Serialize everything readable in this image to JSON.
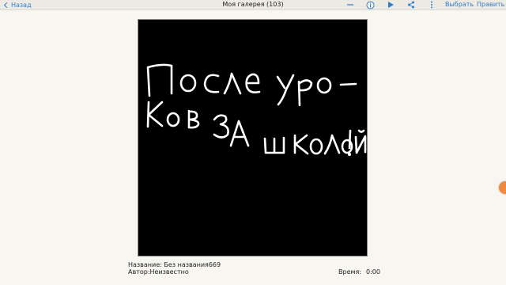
{
  "header": {
    "back_label": "Назад",
    "title": "Моя галерея (103)",
    "select_label": "Выбрать",
    "edit_label": "Править"
  },
  "icons": {
    "minimize": "minus-icon",
    "info": "info-icon",
    "play": "play-icon",
    "share": "share-icon",
    "more": "more-vertical-icon"
  },
  "artwork": {
    "handwriting": "После уро- ков ЗА школой!",
    "background_color": "#000000",
    "stroke_color": "#ffffff"
  },
  "details": {
    "name_label": "Название:",
    "name_value": "Без названия669",
    "author_label": "Автор:",
    "author_value": "Неизвестно",
    "time_label": "Время:",
    "time_value": "0:00"
  },
  "colors": {
    "accent": "#2f7fd1",
    "edge_button": "#f0883e"
  }
}
